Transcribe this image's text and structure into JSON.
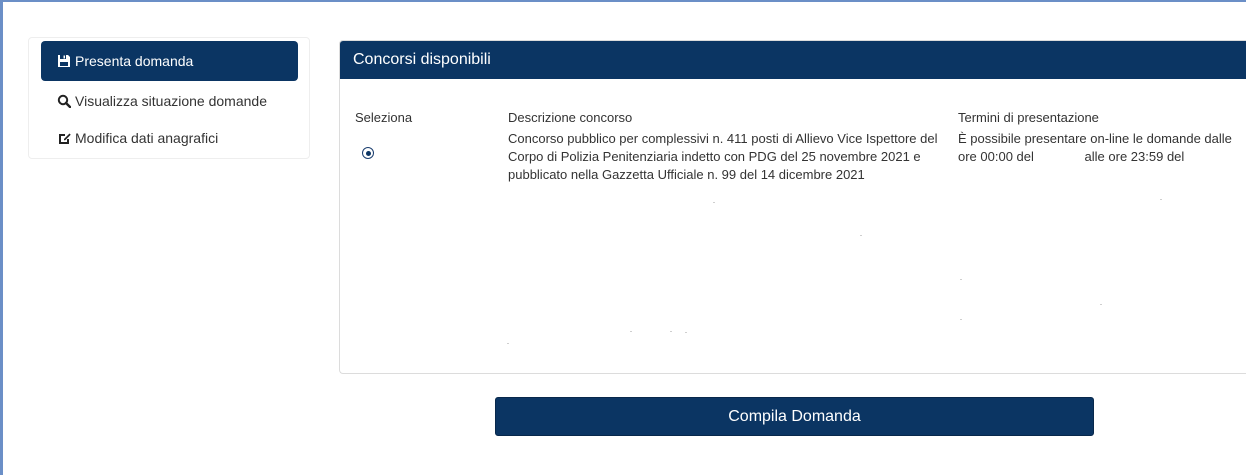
{
  "sidebar": {
    "items": [
      {
        "label": "Presenta domanda",
        "icon": "save-icon",
        "active": true
      },
      {
        "label": "Visualizza situazione domande",
        "icon": "search-icon",
        "active": false
      },
      {
        "label": "Modifica dati anagrafici",
        "icon": "edit-icon",
        "active": false
      }
    ]
  },
  "panel": {
    "title": "Concorsi disponibili",
    "columns": {
      "select": "Seleziona",
      "description": "Descrizione concorso",
      "terms": "Termini di presentazione"
    },
    "row": {
      "selected": true,
      "description": "Concorso pubblico per complessivi n. 411 posti di Allievo Vice Ispettore del Corpo di Polizia Penitenziaria indetto con PDG del 25 novembre 2021 e pubblicato nella Gazzetta Ufficiale n. 99 del 14 dicembre 2021",
      "terms_prefix": "È possibile presentare on-line le domande dalle ore 00:00 del",
      "terms_middle": "alle ore 23:59",
      "terms_suffix": "del"
    }
  },
  "actions": {
    "submit_label": "Compila Domanda"
  },
  "colors": {
    "primary": "#0b3563",
    "frame": "#6b8fc7"
  }
}
